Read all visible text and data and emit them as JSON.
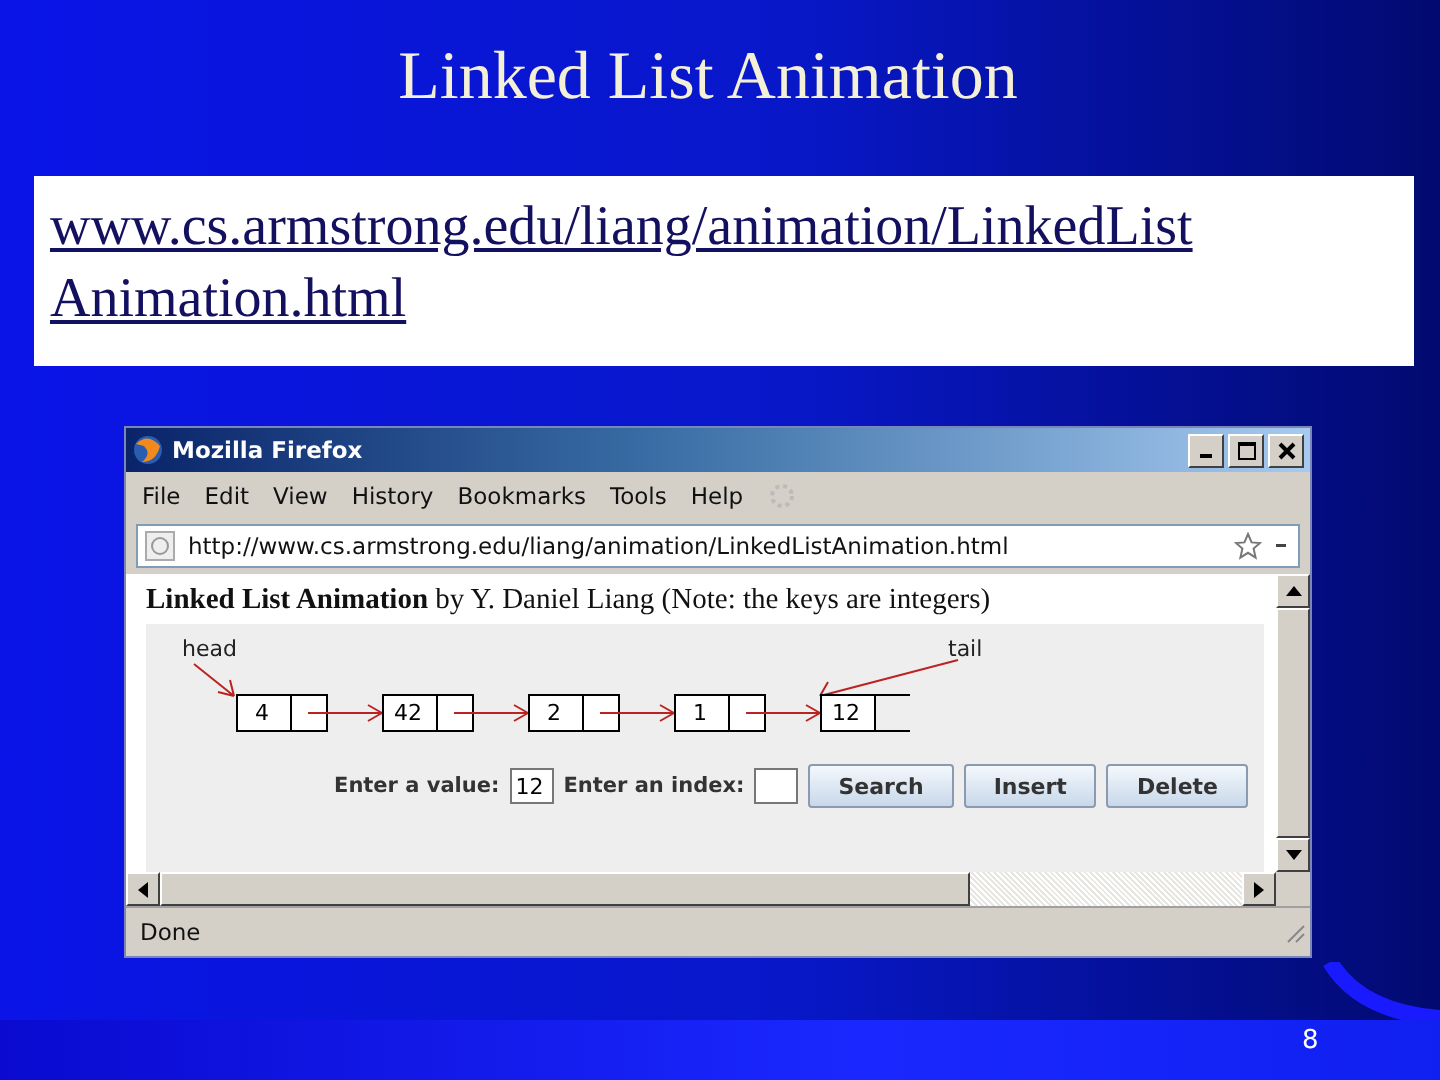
{
  "slide": {
    "title": "Linked List Animation",
    "link_lines": [
      "www.cs.armstrong.edu/liang/animation/LinkedList",
      "Animation.html"
    ],
    "page_number": "8"
  },
  "browser": {
    "title": "Mozilla Firefox",
    "menu": [
      "File",
      "Edit",
      "View",
      "History",
      "Bookmarks",
      "Tools",
      "Help"
    ],
    "url": "http://www.cs.armstrong.edu/liang/animation/LinkedListAnimation.html",
    "heading": "**Linked List Animation** by Y. Daniel Liang (Note: the keys are integers)",
    "list": {
      "head_label": "head",
      "tail_label": "tail",
      "nodes": [
        "4",
        "42",
        "2",
        "1",
        "12"
      ]
    },
    "controls": {
      "value_label": "Enter a value:",
      "value": "12",
      "index_label": "Enter an index:",
      "buttons": [
        "Search",
        "Insert",
        "Delete"
      ]
    },
    "status": "Done"
  }
}
